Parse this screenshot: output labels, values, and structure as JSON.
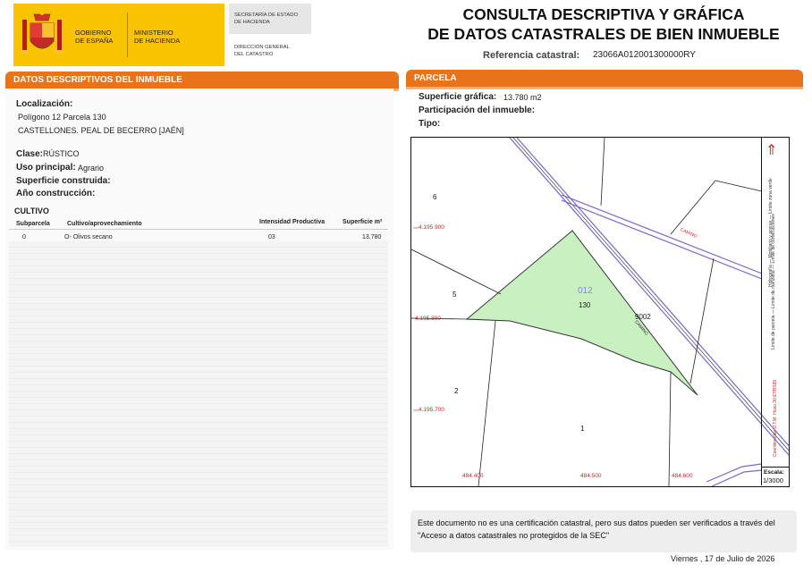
{
  "header": {
    "gobierno_line1": "GOBIERNO",
    "gobierno_line2": "DE ESPAÑA",
    "ministerio_line1": "MINISTERIO",
    "ministerio_line2": "DE HACIENDA",
    "secretaria_line1": "SECRETARÍA DE ESTADO",
    "secretaria_line2": "DE HACIENDA",
    "direccion_line1": "DIRECCIÓN GENERAL",
    "direccion_line2": "DEL CATASTRO",
    "title_line1": "CONSULTA DESCRIPTIVA Y GRÁFICA",
    "title_line2": "DE DATOS CATASTRALES DE BIEN INMUEBLE",
    "ref_label": "Referencia catastral:",
    "ref_value": "23066A012001300000RY",
    "brand_color": "#f8c300",
    "accent_color": "#e8731a"
  },
  "descriptivos": {
    "section_title": "DATOS DESCRIPTIVOS DEL INMUEBLE",
    "localizacion_label": "Localización:",
    "localizacion_line1": "Polígono 12 Parcela 130",
    "localizacion_line2": "CASTELLONES. PEAL DE BECERRO [JAÉN]",
    "clase_label": "Clase:",
    "clase_value": "RÚSTICO",
    "uso_label": "Uso principal:",
    "uso_value": "Agrario",
    "superficie_label": "Superficie construida:",
    "anio_label": "Año construcción:",
    "cultivo_title": "CULTIVO",
    "table": {
      "headers": [
        "Subparcela",
        "Cultivo/aprovechamiento",
        "Intensidad Productiva",
        "Superficie m²"
      ],
      "rows": [
        [
          "0",
          "O- Olivos secano",
          "03",
          "13.780"
        ]
      ]
    }
  },
  "parcela": {
    "section_title": "PARCELA",
    "superficie_label": "Superficie gráfica:",
    "superficie_value": "13.780 m2",
    "participacion_label": "Participación del inmueble:",
    "tipo_label": "Tipo:",
    "map": {
      "parcel_fill": "#c8f0c0",
      "parcel_polygon": "012",
      "parcel_number": "130",
      "road_label": "9002",
      "camino_label": "CAMINO",
      "neighbor_labels": [
        "6",
        "5",
        "2",
        "1"
      ],
      "coord_y": [
        "4.195.900",
        "4.195.800",
        "4.195.700"
      ],
      "coord_x": [
        "484.400",
        "484.500",
        "484.600"
      ],
      "north_symbol": "⇑",
      "legend_items": [
        "Hidrografía",
        "Límite de parcela",
        "Límite de manzana",
        "Límite de construcciones",
        "Mobiliario y aceras",
        "Límite zona verde"
      ],
      "coord_system": "Coordenadas U.T.M. Huso 30 ETRS89",
      "escala_label": "Escala:",
      "escala_value": "1/3000"
    },
    "notice": "Este documento no es una certificación catastral, pero sus datos pueden ser verificados a través del \"Acceso a datos catastrales no protegidos de la SEC\"",
    "date": "Viernes , 17 de Julio de 2026"
  }
}
